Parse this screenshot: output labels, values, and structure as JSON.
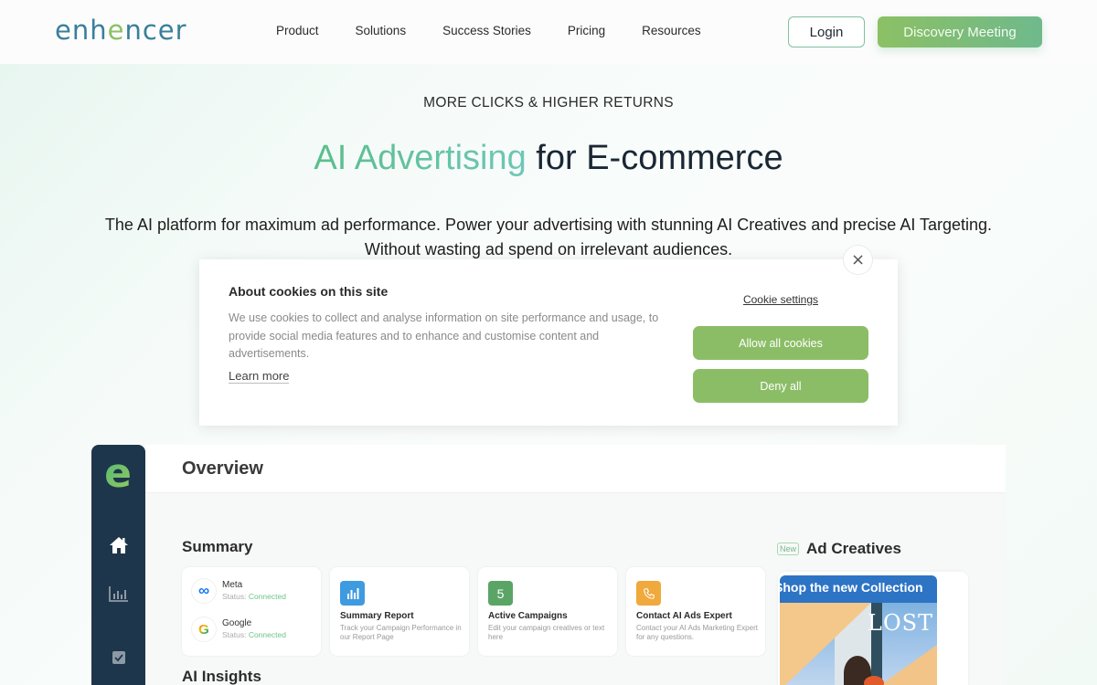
{
  "header": {
    "logo": {
      "prefix": "enh",
      "accent": "e",
      "suffix": "ncer"
    },
    "nav": [
      "Product",
      "Solutions",
      "Success Stories",
      "Pricing",
      "Resources"
    ],
    "login_label": "Login",
    "cta_label": "Discovery Meeting"
  },
  "hero": {
    "eyebrow": "MORE CLICKS & HIGHER RETURNS",
    "title_accent": "AI Advertising",
    "title_rest": " for E-commerce",
    "subtitle": "The AI platform for maximum ad performance. Power your advertising with stunning AI Creatives and precise AI Targeting. Without wasting ad spend on irrelevant audiences."
  },
  "cookie": {
    "title": "About cookies on this site",
    "body": "We use cookies to collect and analyse information on site performance and usage, to provide social media features and to enhance and customise content and advertisements.",
    "learn_more": "Learn more",
    "settings": "Cookie settings",
    "allow": "Allow all cookies",
    "deny": "Deny all",
    "close_icon": "×"
  },
  "dashboard": {
    "logo_letter": "e",
    "title": "Overview",
    "summary_title": "Summary",
    "insights_title": "AI Insights",
    "connections": [
      {
        "name": "Meta",
        "status_label": "Status: ",
        "status": "Connected",
        "icon": "∞"
      },
      {
        "name": "Google",
        "status_label": "Status: ",
        "status": "Connected",
        "icon": "G"
      }
    ],
    "cards": [
      {
        "title": "Summary Report",
        "desc": "Track your Campaign Performance in our Report Page",
        "icon": "chart",
        "color": "#3f9be0"
      },
      {
        "title": "Active Campaigns",
        "desc": "Edit your campaign creatives or text here",
        "icon": "5",
        "color": "#5aa566"
      },
      {
        "title": "Contact AI Ads Expert",
        "desc": "Contact your AI Ads Marketing Expert for any questions.",
        "icon": "phone",
        "color": "#f0a93c"
      }
    ],
    "ad_creatives": {
      "badge": "New",
      "title": "Ad Creatives",
      "headline": "Shop the new Collection",
      "brand": "LOST"
    }
  },
  "colors": {
    "brand_blue": "#3a7f9c",
    "brand_green": "#8cc064",
    "accent_teal": "#5bbd8c",
    "sidebar": "#1e364b",
    "button_green": "#8bbd66"
  }
}
